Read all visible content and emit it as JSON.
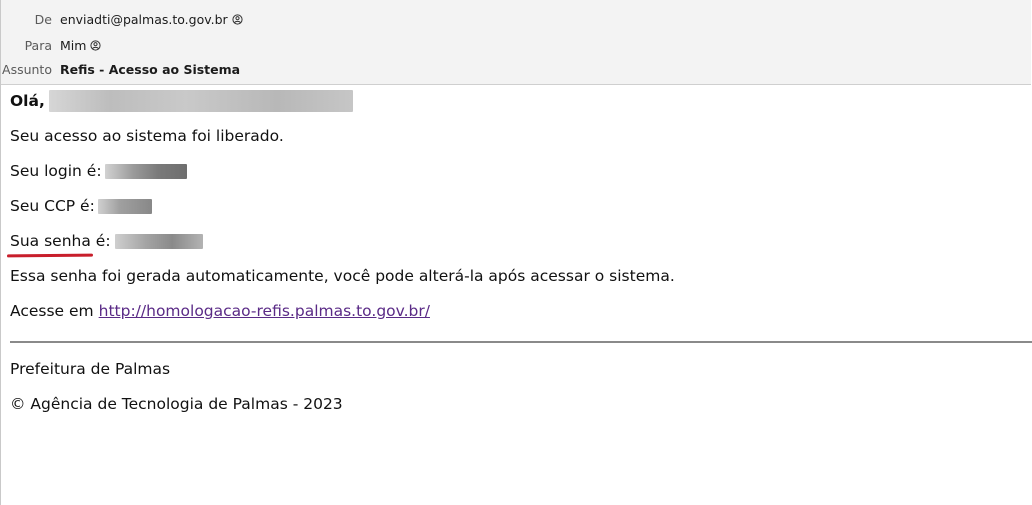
{
  "header": {
    "from_label": "De",
    "from_value": "enviadti@palmas.to.gov.br",
    "to_label": "Para",
    "to_value": "Mim",
    "subject_label": "Assunto",
    "subject_value": "Refis - Acesso ao Sistema"
  },
  "body": {
    "greeting": "Olá,",
    "access_line": "Seu acesso ao sistema foi liberado.",
    "login_label": "Seu login é:",
    "ccp_label": "Seu CCP é:",
    "password_label_underlined": "Sua senha",
    "password_label_rest": " é:",
    "note": "Essa senha foi gerada automaticamente, você pode alterá-la após acessar o sistema.",
    "access_prefix": "Acesse em",
    "access_link": "http://homologacao-refis.palmas.to.gov.br/"
  },
  "footer": {
    "org": "Prefeitura de Palmas",
    "copyright": "© Agência de Tecnologia de Palmas - 2023"
  },
  "colors": {
    "link": "#5a2a86",
    "annotation_underline": "#c81e2b",
    "header_bg": "#f3f3f3"
  }
}
